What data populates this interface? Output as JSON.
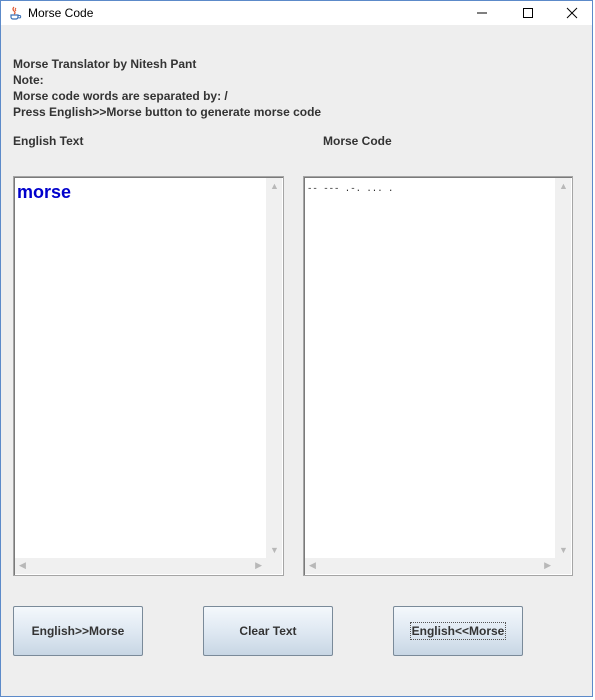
{
  "window": {
    "title": "Morse Code",
    "icons": {
      "app": "java-icon",
      "minimize": "minimize-icon",
      "maximize": "maximize-icon",
      "close": "close-icon"
    }
  },
  "info": {
    "line1": "Morse Translator by Nitesh Pant",
    "line2": "Note:",
    "line3": "Morse code words are separated by: /",
    "line4": "Press English>>Morse button to generate morse code"
  },
  "english": {
    "label": "English Text",
    "value": "morse"
  },
  "morse": {
    "label": "Morse Code",
    "value": "-- --- .-. ... ."
  },
  "buttons": {
    "english_to_morse": "English>>Morse",
    "clear": "Clear Text",
    "morse_to_english": "English<<Morse"
  },
  "colors": {
    "input_text": "#0000cc",
    "window_bg": "#eeeeee"
  }
}
